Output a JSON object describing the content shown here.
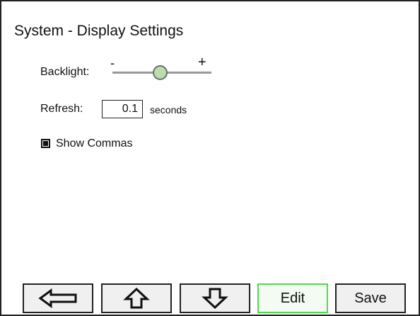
{
  "screen": {
    "title": "System - Display Settings"
  },
  "backlight": {
    "label": "Backlight:",
    "minus_label": "-",
    "plus_label": "+",
    "level": 0.48,
    "thumb_color": "#b9ddac"
  },
  "refresh": {
    "label": "Refresh:",
    "value": "0.1",
    "unit": "seconds"
  },
  "show_commas": {
    "label": "Show Commas",
    "checked": true
  },
  "buttons": {
    "left_icon": "left-arrow-icon",
    "up_icon": "up-arrow-icon",
    "down_icon": "down-arrow-icon",
    "edit_label": "Edit",
    "save_label": "Save",
    "edit_border_color": "#4ddb4d"
  }
}
